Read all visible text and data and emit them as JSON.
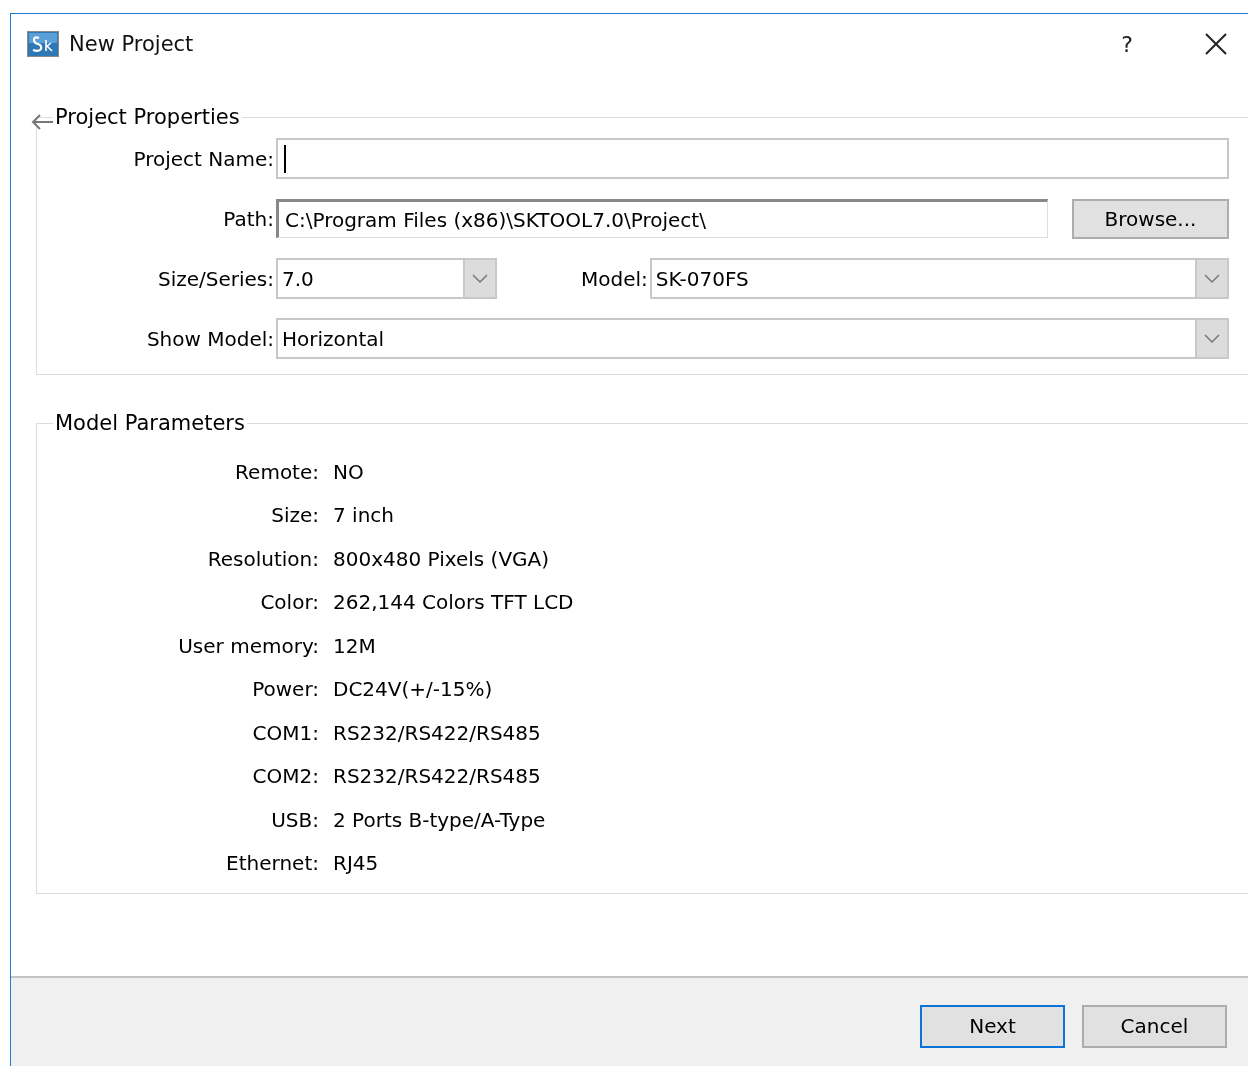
{
  "window": {
    "title": "New Project"
  },
  "help_button": {
    "label": "?"
  },
  "project_properties": {
    "title": "Project Properties",
    "rows": [
      {
        "fields": [
          {
            "kind": "text",
            "label": "Project Name:",
            "focused": true
          }
        ]
      },
      {
        "fields": [
          {
            "kind": "text",
            "label": "Path:",
            "value": "C:\\Program Files (x86)\\SKTOOL7.0\\Project\\",
            "focused": false,
            "button": "Browse..."
          }
        ]
      },
      {
        "fields": [
          {
            "kind": "combo",
            "label": "Size/Series:",
            "value": "7.0"
          },
          {
            "kind": "combo",
            "label": "Model:",
            "value": "SK-070FS"
          }
        ]
      },
      {
        "fields": [
          {
            "kind": "combo",
            "label": "Show Model:",
            "value": "Horizontal"
          }
        ]
      }
    ]
  },
  "model_parameters": {
    "title": "Model Parameters",
    "items": [
      {
        "label": "Remote:",
        "value": "NO"
      },
      {
        "label": "Size:",
        "value": "7 inch"
      },
      {
        "label": "Resolution:",
        "value": "800x480 Pixels (VGA)"
      },
      {
        "label": "Color:",
        "value": "262,144 Colors TFT LCD"
      },
      {
        "label": "User memory:",
        "value": "12M"
      },
      {
        "label": "Power:",
        "value": "DC24V(+/-15%)"
      },
      {
        "label": "COM1:",
        "value": "RS232/RS422/RS485"
      },
      {
        "label": "COM2:",
        "value": "RS232/RS422/RS485"
      },
      {
        "label": "USB:",
        "value": "2 Ports B-type/A-Type"
      },
      {
        "label": "Ethernet:",
        "value": "RJ45"
      }
    ]
  },
  "buttons": [
    {
      "label": "Next",
      "default": true
    },
    {
      "label": "Cancel",
      "default": false
    }
  ]
}
